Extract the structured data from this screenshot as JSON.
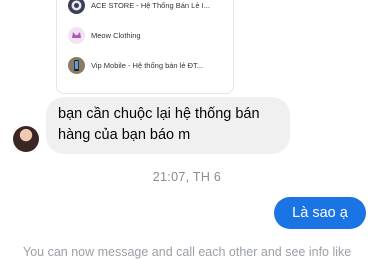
{
  "shared_shops": [
    {
      "name": "ACE STORE - Hệ Thống Bán Lẻ I...",
      "logo": "ace-store-logo"
    },
    {
      "name": "Meow Clothing",
      "logo": "meow-clothing-logo"
    },
    {
      "name": "Vip Mobile - Hệ thống bán lẻ ĐT...",
      "logo": "vip-mobile-logo"
    }
  ],
  "incoming_message": "bạn cần chuộc lại hệ thống bán hàng của bạn báo m",
  "timestamp": "21:07, TH 6",
  "outgoing_message": "Là sao ạ",
  "info_text": "You can now message and call each other and see info like",
  "colors": {
    "outgoing_bubble": "#1b74e4",
    "incoming_bubble": "#f0f0f0"
  }
}
